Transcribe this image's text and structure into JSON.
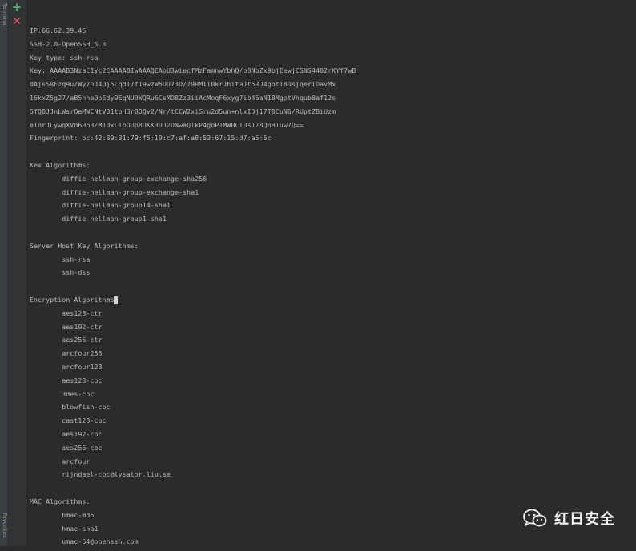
{
  "sidebar": {
    "top_label": "Terminal",
    "bottom_label": "Favorites"
  },
  "toolbar": {
    "add_label": "+",
    "close_label": "✕"
  },
  "console": {
    "lines": [
      "IP:66.62.39.46",
      "SSH-2.0-OpenSSH_5.3",
      "Key type: ssh-rsa",
      "Key: AAAAB3NzaC1yc2EAAAABIwAAAQEAoU3wiecfMzFamnwYbhQ/p8NbZx9bjEewjCSNS4402rKYf7wB",
      "0AjsSRFzq9u/Wy7nJ4Oj5LqdT7f19wzW5OU73D/790MIT0krJhitaJt5RD4goti8DsjqerIDavMx",
      "16kxZ5g27/aB5hhe0pEdy9EqNU0WQRu6CsMO8Zz3iiAcMoqF6xyg7ib46aN18MgptVhqub8af12s",
      "5fQ8JJnLWsrOeMWCNtV31tpH3rBOQv2/Nr/tCCW2xiSru2d5un+nlxIDj17T8CuN6/RUptZBiUzm",
      "eInrJLywqXVn60b3/M1dxLipOUp8DKK3DJ2ONwaQlkP4goP1MW0LI0s178QnB1uw7Q==",
      "Fingerprint: bc:42:89:31:79:f5:19:c7:af:a8:53:67:15:d7:a5:5c",
      "",
      "Kex Algorithms:",
      "        diffie-hellman-group-exchange-sha256",
      "        diffie-hellman-group-exchange-sha1",
      "        diffie-hellman-group14-sha1",
      "        diffie-hellman-group1-sha1",
      "",
      "Server Host Key Algorithms:",
      "        ssh-rsa",
      "        ssh-dss",
      "",
      "Encryption Algorithms",
      "        aes128-ctr",
      "        aes192-ctr",
      "        aes256-ctr",
      "        arcfour256",
      "        arcfour128",
      "        aes128-cbc",
      "        3des-cbc",
      "        blowfish-cbc",
      "        cast128-cbc",
      "        aes192-cbc",
      "        aes256-cbc",
      "        arcfour",
      "        rijndael-cbc@lysator.liu.se",
      "",
      "MAC Algorithms:",
      "        hmac-md5",
      "        hmac-sha1",
      "        umac-64@openssh.com"
    ]
  },
  "watermark": {
    "text": "红日安全",
    "icon": "wechat-icon"
  },
  "colors": {
    "background": "#2b2b2b",
    "text": "#bbbbbb",
    "add": "#59a869",
    "close": "#e05555"
  }
}
